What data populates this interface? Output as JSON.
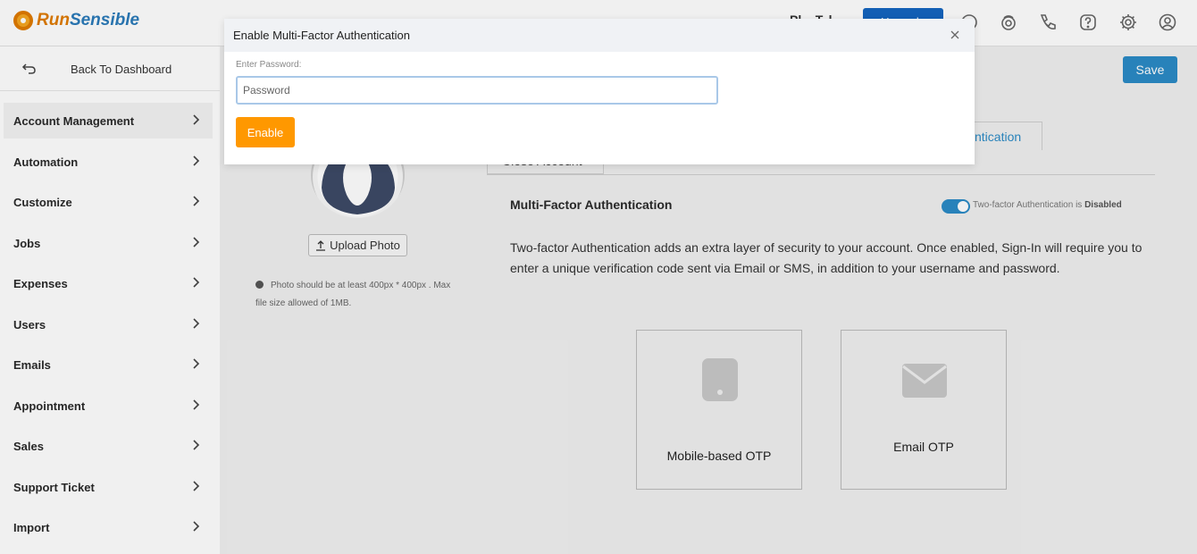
{
  "header": {
    "logo_run": "Run",
    "logo_sensible": "Sensible",
    "plan_text": "Pl... T..l..",
    "upgrade_label": "Upgrade",
    "icons": [
      "chat-icon",
      "headset-icon",
      "phone-icon",
      "help-icon",
      "gear-icon",
      "user-icon"
    ]
  },
  "sidebar": {
    "back_label": "Back To Dashboard",
    "items": [
      {
        "label": "Account Management"
      },
      {
        "label": "Automation"
      },
      {
        "label": "Customize"
      },
      {
        "label": "Jobs"
      },
      {
        "label": "Expenses"
      },
      {
        "label": "Users"
      },
      {
        "label": "Emails"
      },
      {
        "label": "Appointment"
      },
      {
        "label": "Sales"
      },
      {
        "label": "Support Ticket"
      },
      {
        "label": "Import"
      }
    ]
  },
  "main": {
    "save_label": "Save",
    "tab_active_partial": "ntication",
    "tab_close_account": "Close Account",
    "upload_photo_label": "Upload Photo",
    "photo_note": "Photo should be at least 400px * 400px . Max file size allowed of 1MB.",
    "mfa_title": "Multi-Factor Authentication",
    "toggle_prefix": "Two-factor Authentication is ",
    "toggle_state": "Disabled",
    "mfa_description": "Two-factor Authentication adds an extra layer of security to your account. Once enabled, Sign-In will require you to enter a unique verification code sent via Email or SMS, in addition to your username and password.",
    "otp_options": [
      {
        "label": "Mobile-based OTP",
        "icon": "mobile-icon"
      },
      {
        "label": "Email OTP",
        "icon": "envelope-icon"
      }
    ]
  },
  "modal": {
    "title": "Enable Multi-Factor Authentication",
    "field_label": "Enter Password:",
    "password_placeholder": "Password",
    "password_value": "",
    "enable_label": "Enable"
  },
  "colors": {
    "primary": "#2b8bc6",
    "upgrade": "#1565c0",
    "enable_button": "#ff9800",
    "logo_orange": "#e07b00",
    "logo_blue": "#2b7bb9"
  }
}
